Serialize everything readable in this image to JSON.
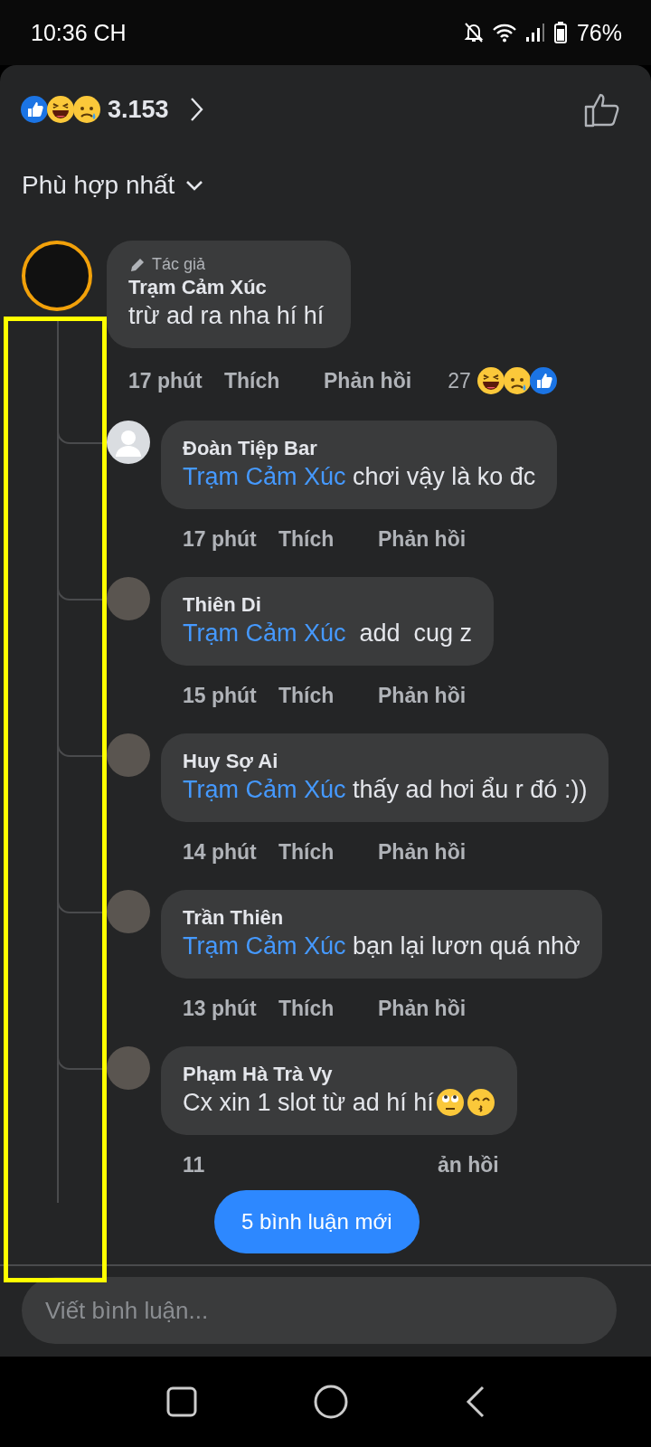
{
  "status_bar": {
    "time": "10:36 CH",
    "battery": "76%"
  },
  "reactions_header": {
    "reactions": [
      {
        "kind": "like"
      },
      {
        "kind": "haha"
      },
      {
        "kind": "sad"
      }
    ],
    "count": "3.153"
  },
  "sort": {
    "label": "Phù hợp nhất"
  },
  "comment": {
    "badge": "Tác giả",
    "author": "Trạm Cảm Xúc",
    "text": "trừ ad ra nha hí hí",
    "meta": {
      "time": "17 phút",
      "like": "Thích",
      "reply": "Phản hồi"
    },
    "reaction_count": "27",
    "reactions": [
      {
        "kind": "haha"
      },
      {
        "kind": "sad"
      },
      {
        "kind": "like"
      }
    ]
  },
  "replies": [
    {
      "kind": "default",
      "author": "Đoàn Tiệp Bar",
      "mention": "Trạm Cảm Xúc",
      "text": "chơi vậy là ko đc",
      "meta": {
        "time": "17 phút",
        "like": "Thích",
        "reply": "Phản hồi",
        "covered": false
      }
    },
    {
      "kind": "photo",
      "author": "Thiên Di",
      "mention": "Trạm Cảm Xúc",
      "text": " add  cug z",
      "meta": {
        "time": "15 phút",
        "like": "Thích",
        "reply": "Phản hồi",
        "covered": false
      }
    },
    {
      "kind": "photo",
      "author": "Huy Sợ Ai",
      "mention": "Trạm Cảm Xúc",
      "text": "thấy ad hơi ẩu r đó :))",
      "meta": {
        "time": "14 phút",
        "like": "Thích",
        "reply": "Phản hồi",
        "covered": false
      }
    },
    {
      "kind": "photo",
      "author": "Trần Thiên",
      "mention": "Trạm Cảm Xúc",
      "text": "bạn lại lươn quá nhờ",
      "meta": {
        "time": "13 phút",
        "like": "Thích",
        "reply": "Phản hồi",
        "covered": false
      }
    },
    {
      "kind": "photo",
      "author": "Phạm Hà Trà Vy",
      "text": "Cx xin 1 slot từ ad hí hí",
      "emojis": [
        {
          "kind": "eye-roll"
        },
        {
          "kind": "kiss"
        }
      ],
      "meta": {
        "time": "11",
        "reply": "ản hồi",
        "covered": true
      }
    }
  ],
  "new_comments_button": {
    "label": "5 bình luận mới"
  },
  "comment_input": {
    "placeholder": "Viết bình luận..."
  }
}
